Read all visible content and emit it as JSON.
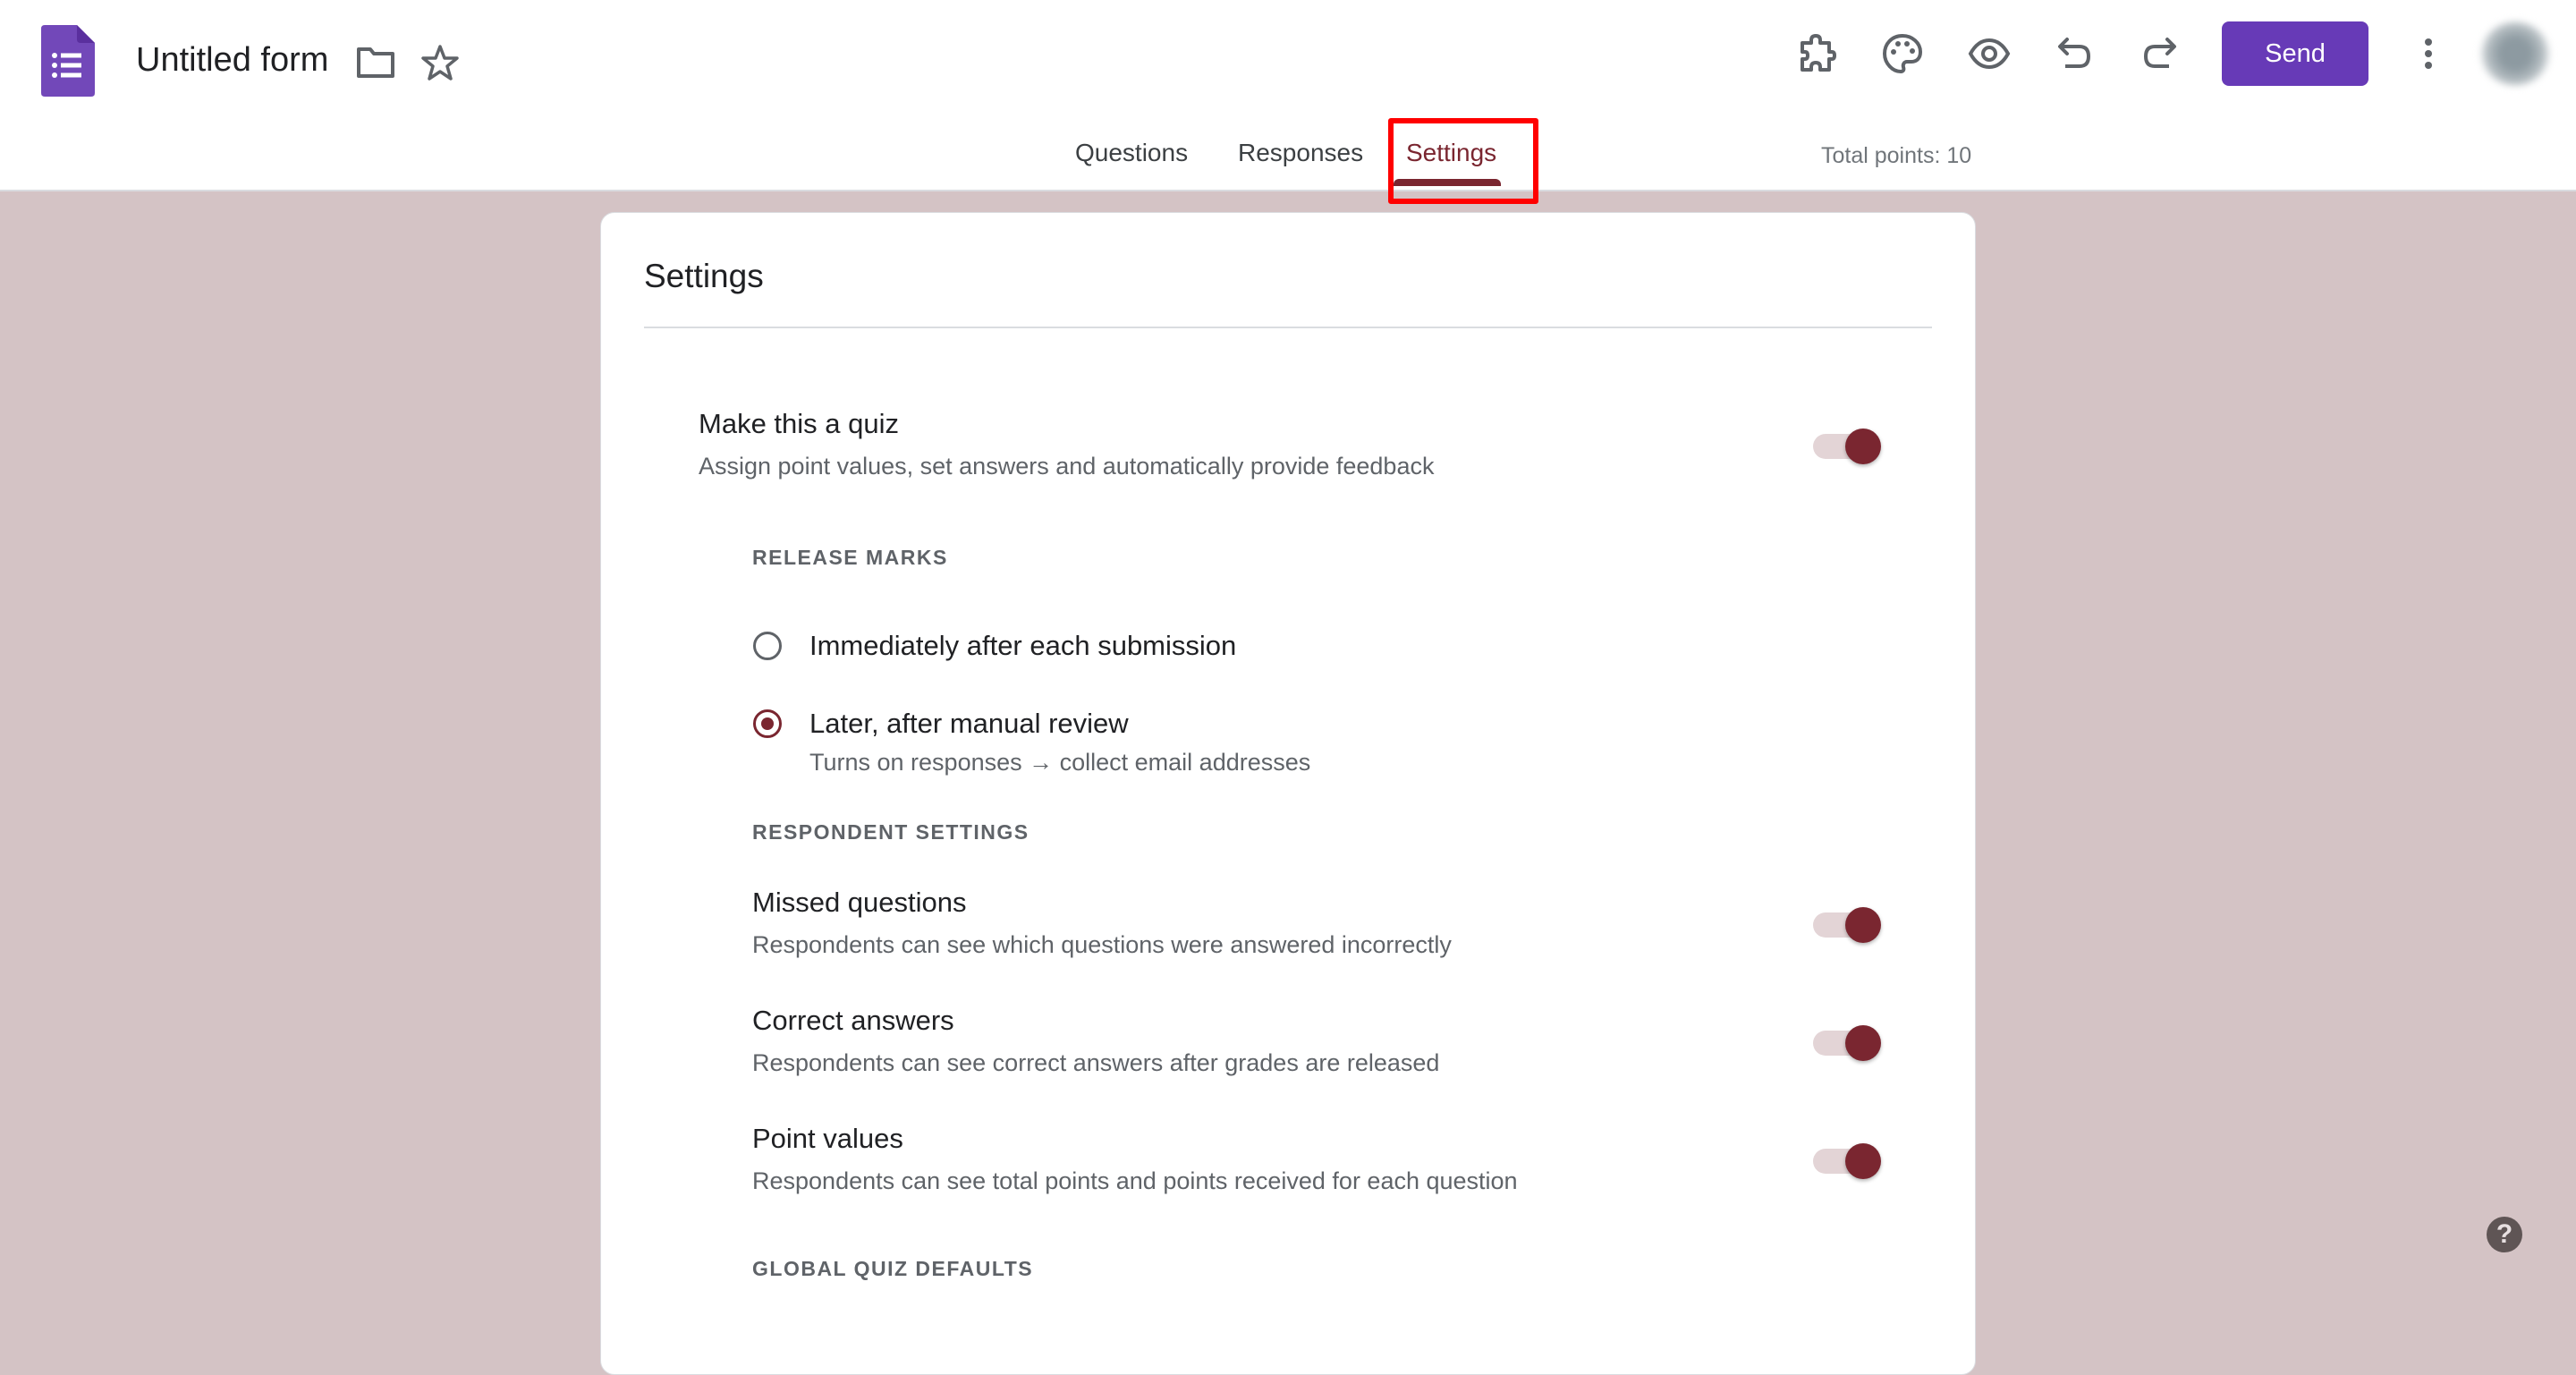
{
  "header": {
    "doc_title": "Untitled form",
    "icons": {
      "logo": "google-forms-logo",
      "folder": "folder-icon",
      "star": "star-icon",
      "addons": "puzzle-icon",
      "theme": "palette-icon",
      "preview": "eye-icon",
      "undo": "undo-icon",
      "redo": "redo-icon",
      "more": "more-vert-icon"
    },
    "send_label": "Send",
    "brand_color": "#673ab7"
  },
  "tabs": [
    {
      "label": "Questions",
      "active": false
    },
    {
      "label": "Responses",
      "active": false
    },
    {
      "label": "Settings",
      "active": true
    }
  ],
  "total_points": "Total points: 10",
  "accent_color": "#7a2630",
  "settings": {
    "title": "Settings",
    "quiz": {
      "title": "Make this a quiz",
      "description": "Assign point values, set answers and automatically provide feedback",
      "enabled": true
    },
    "release_marks": {
      "label": "RELEASE MARKS",
      "options": [
        {
          "label": "Immediately after each submission",
          "selected": false
        },
        {
          "label": "Later, after manual review",
          "selected": true,
          "note": "Turns on responses → collect email addresses"
        }
      ]
    },
    "respondent_settings": {
      "label": "RESPONDENT SETTINGS",
      "items": [
        {
          "title": "Missed questions",
          "description": "Respondents can see which questions were answered incorrectly",
          "enabled": true
        },
        {
          "title": "Correct answers",
          "description": "Respondents can see correct answers after grades are released",
          "enabled": true
        },
        {
          "title": "Point values",
          "description": "Respondents can see total points and points received for each question",
          "enabled": true
        }
      ]
    },
    "global_quiz_defaults": {
      "label": "GLOBAL QUIZ DEFAULTS"
    }
  },
  "help": {
    "label": "?"
  }
}
